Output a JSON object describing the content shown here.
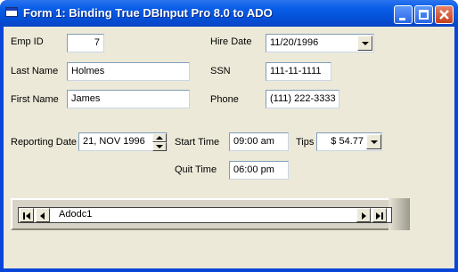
{
  "window": {
    "title": "Form 1: Binding True DBInput Pro 8.0 to ADO",
    "title_color": "#ffffff",
    "titlebar_color": "#0a5ee8",
    "client_color": "#ece9d8"
  },
  "fields": {
    "emp_id": {
      "label": "Emp ID",
      "value": "7"
    },
    "last_name": {
      "label": "Last Name",
      "value": "Holmes"
    },
    "first_name": {
      "label": "First Name",
      "value": "James"
    },
    "hire_date": {
      "label": "Hire Date",
      "value": "11/20/1996"
    },
    "ssn": {
      "label": "SSN",
      "value": "111-11-1111"
    },
    "phone": {
      "label": "Phone",
      "value": "(111) 222-3333"
    },
    "reporting_date": {
      "label": "Reporting Date",
      "value": "21, NOV 1996"
    },
    "start_time": {
      "label": "Start Time",
      "value": "09:00 am"
    },
    "tips": {
      "label": "Tips",
      "value": "$ 54.77"
    },
    "quit_time": {
      "label": "Quit Time",
      "value": "06:00 pm"
    }
  },
  "adodc": {
    "caption": "Adodc1",
    "buttons": [
      "first-record",
      "previous-record",
      "next-record",
      "last-record"
    ]
  },
  "icons": [
    "app-icon",
    "minimize-icon",
    "maximize-icon",
    "close-icon",
    "chevron-down-icon",
    "spin-up-icon",
    "spin-down-icon"
  ]
}
